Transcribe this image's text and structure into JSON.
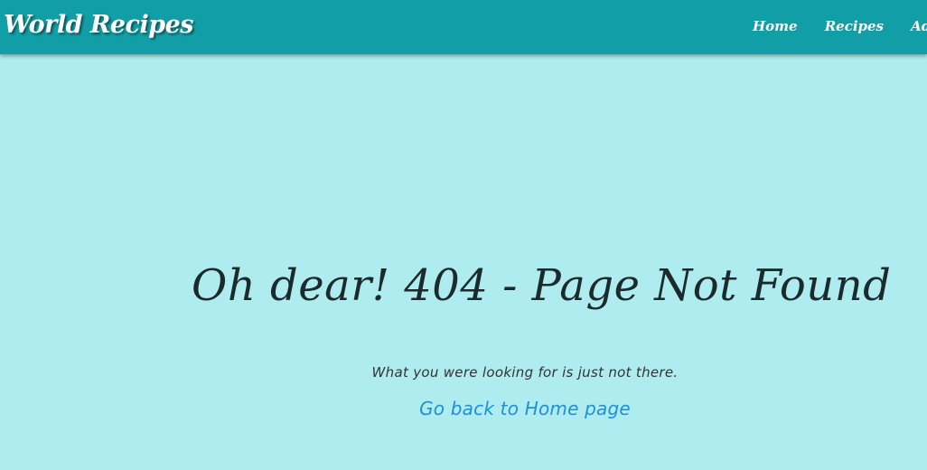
{
  "navbar": {
    "brand": "World Recipes",
    "links": [
      {
        "label": "Home"
      },
      {
        "label": "Recipes"
      },
      {
        "label": "Add Re"
      }
    ]
  },
  "main": {
    "headline": "Oh dear! 404 - Page Not Found",
    "message": "What you were looking for is just not there.",
    "home_link": "Go back to Home page"
  },
  "colors": {
    "navbar_bg": "#119ea6",
    "page_bg": "#aeecef",
    "link": "#1f8fd6",
    "headline": "#1b2a2a"
  }
}
